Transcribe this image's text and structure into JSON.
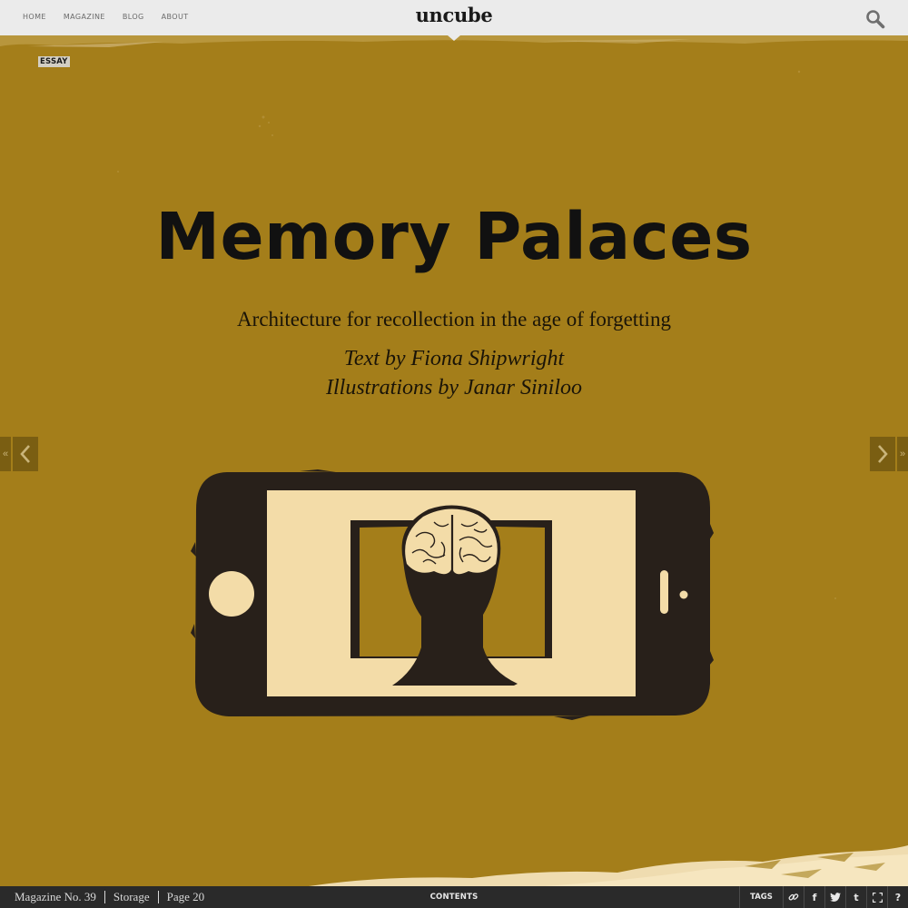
{
  "nav": {
    "items": [
      {
        "label": "HOME"
      },
      {
        "label": "MAGAZINE"
      },
      {
        "label": "BLOG"
      },
      {
        "label": "ABOUT"
      }
    ],
    "logo": "uncube"
  },
  "article": {
    "category": "ESSAY",
    "title": "Memory Palaces",
    "subtitle": "Architecture for recollection in the age of forgetting",
    "byline_text": "Text by Fiona Shipwright",
    "byline_illustrations": "Illustrations by Janar Siniloo"
  },
  "pager": {
    "prev_far": "«",
    "next_far": "»"
  },
  "footer": {
    "magazine": "Magazine No. 39",
    "section": "Storage",
    "page": "Page 20",
    "contents_label": "CONTENTS",
    "tags_label": "TAGS",
    "help_label": "?",
    "share_facebook": "f",
    "share_tumblr": "t"
  },
  "icons": {
    "search": "search-icon",
    "prev": "chevron-left-icon",
    "next": "chevron-right-icon",
    "link": "link-icon",
    "twitter": "twitter-icon",
    "fullscreen": "fullscreen-icon"
  },
  "colors": {
    "background": "#a47e1a",
    "topbar": "#ebebeb",
    "bottombar": "#2a2a2a",
    "illustration_dark": "#28201a",
    "illustration_light": "#f3dca8"
  }
}
